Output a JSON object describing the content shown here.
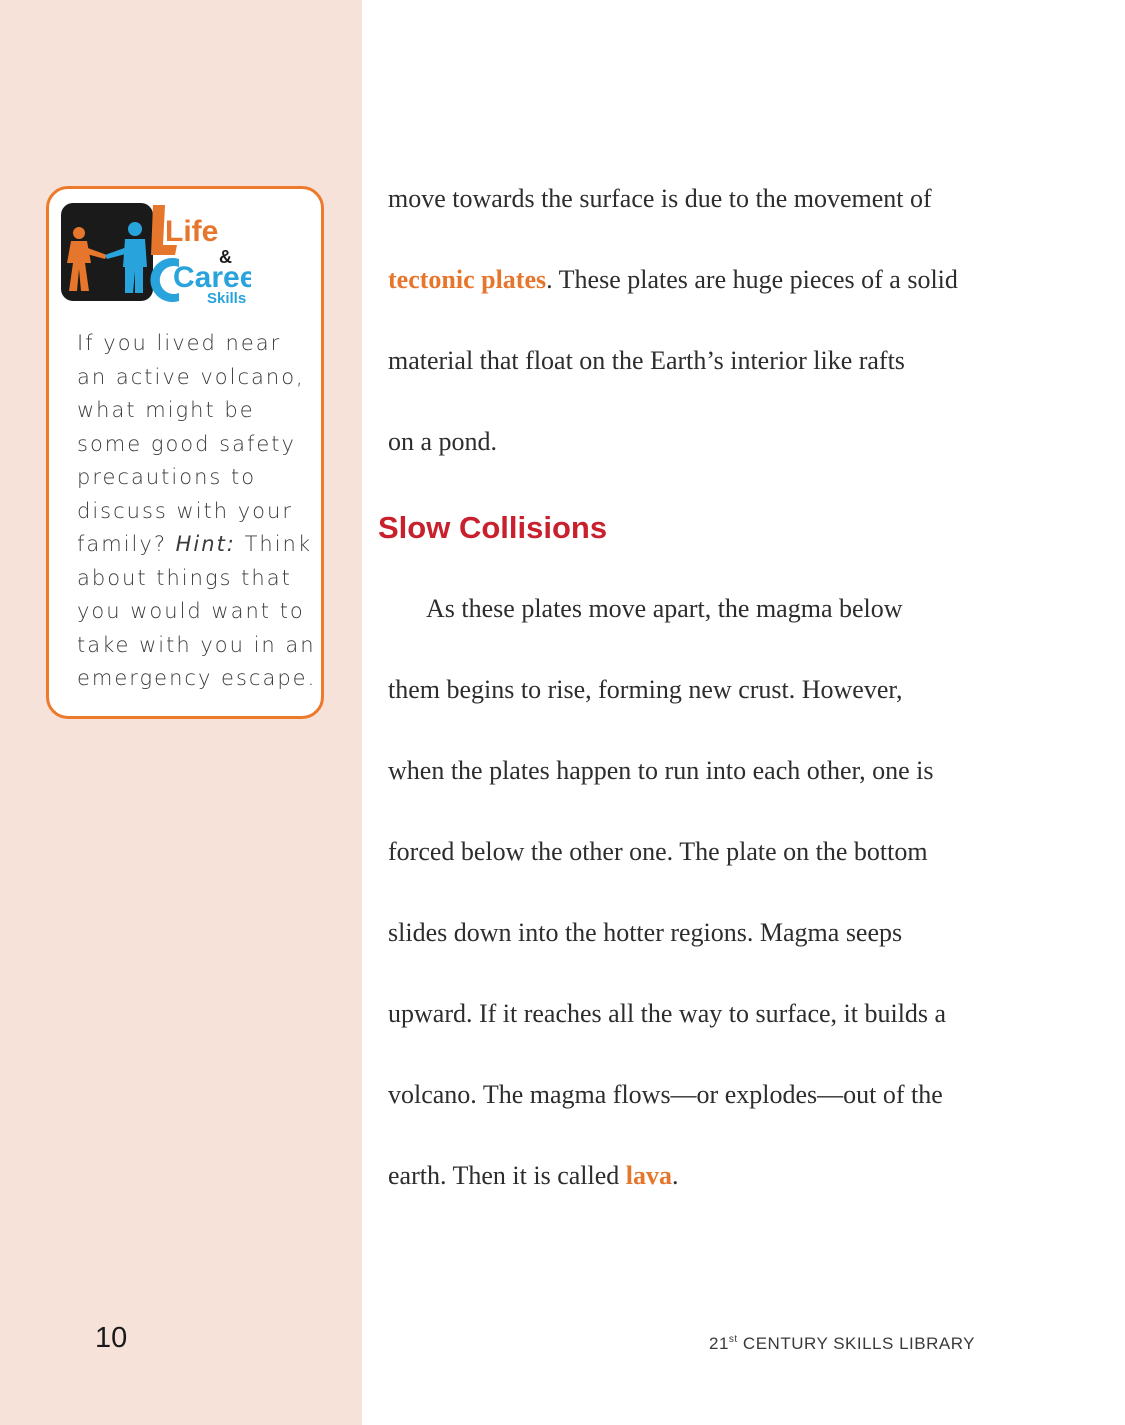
{
  "sidebar": {
    "logo": {
      "word1": "Life",
      "amp": "&",
      "word2": "Career",
      "word3": "Skills",
      "colors": {
        "orange": "#e5762c",
        "blue": "#29a3dc",
        "black": "#1a1a1a"
      }
    },
    "callout": {
      "lines": [
        "If you lived near",
        "an active volcano,",
        "what might be",
        "some good safety",
        "precautions to",
        "discuss with your"
      ],
      "hint_line_prefix": "family? ",
      "hint_label": "Hint:",
      "hint_line_suffix": " Think",
      "lines_after": [
        "about things that",
        "you would want to",
        "take with you in an",
        "emergency escape."
      ]
    }
  },
  "body": {
    "p1": {
      "line1": "move towards the surface is due to the movement of",
      "line2_term": "tectonic plates",
      "line2_rest": ". These plates are huge pieces of a solid",
      "line3": "material that float on the Earth’s interior like rafts",
      "line4": "on a pond."
    },
    "heading": "Slow Collisions",
    "p2": {
      "line1": "As these plates move apart, the magma below",
      "line2": "them begins to rise, forming new crust. However,",
      "line3": "when the plates happen to run into each other, one is",
      "line4": "forced below the other one. The plate on the bottom",
      "line5": "slides down into the hotter regions. Magma seeps",
      "line6": "upward. If it reaches all the way to surface, it builds a",
      "line7": "volcano. The magma flows—or explodes—out of the",
      "line8_prefix": "earth. Then it is called ",
      "line8_term": "lava",
      "line8_suffix": "."
    }
  },
  "footer": {
    "page_number": "10",
    "series_num": "21",
    "series_sup": "st",
    "series_rest": " CENTURY SKILLS LIBRARY"
  },
  "colors": {
    "sidebar_bg": "#f7e2da",
    "callout_border": "#ec7a2a",
    "heading": "#c8202c",
    "highlight": "#e5762c"
  }
}
